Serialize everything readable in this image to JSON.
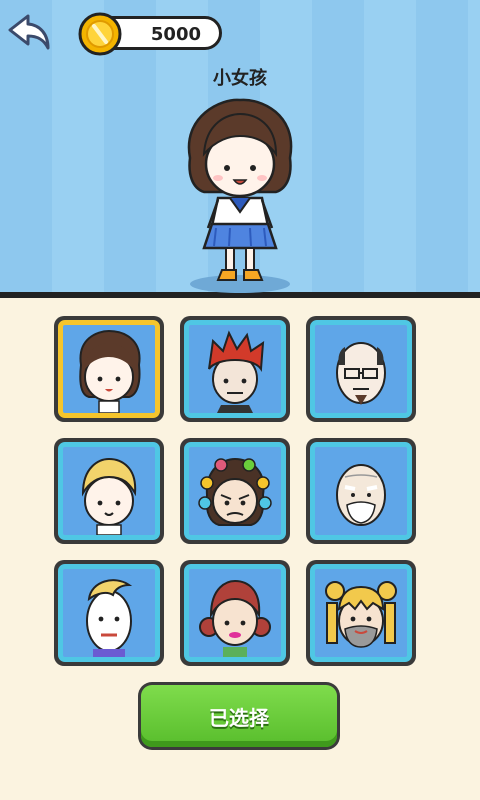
{
  "header": {
    "back_icon": "back-arrow-icon",
    "coin_icon": "gold-coin-icon",
    "coins": "5000"
  },
  "character": {
    "name": "小女孩"
  },
  "characters": [
    {
      "id": "little-girl",
      "selected": true
    },
    {
      "id": "punk-boy",
      "selected": false
    },
    {
      "id": "bald-man-glasses",
      "selected": false
    },
    {
      "id": "blonde-boy",
      "selected": false
    },
    {
      "id": "angry-auntie-curlers",
      "selected": false
    },
    {
      "id": "old-grandpa",
      "selected": false
    },
    {
      "id": "quiff-guy",
      "selected": false
    },
    {
      "id": "red-hair-girl",
      "selected": false
    },
    {
      "id": "bearded-odango-man",
      "selected": false
    }
  ],
  "footer": {
    "confirm_label": "已选择"
  },
  "colors": {
    "sky": "#8ec8ee",
    "panel_bg": "#fbf3e0",
    "card_border": "#4fc7e4",
    "selected_border": "#f5c52c",
    "button_green": "#6acd3b"
  }
}
